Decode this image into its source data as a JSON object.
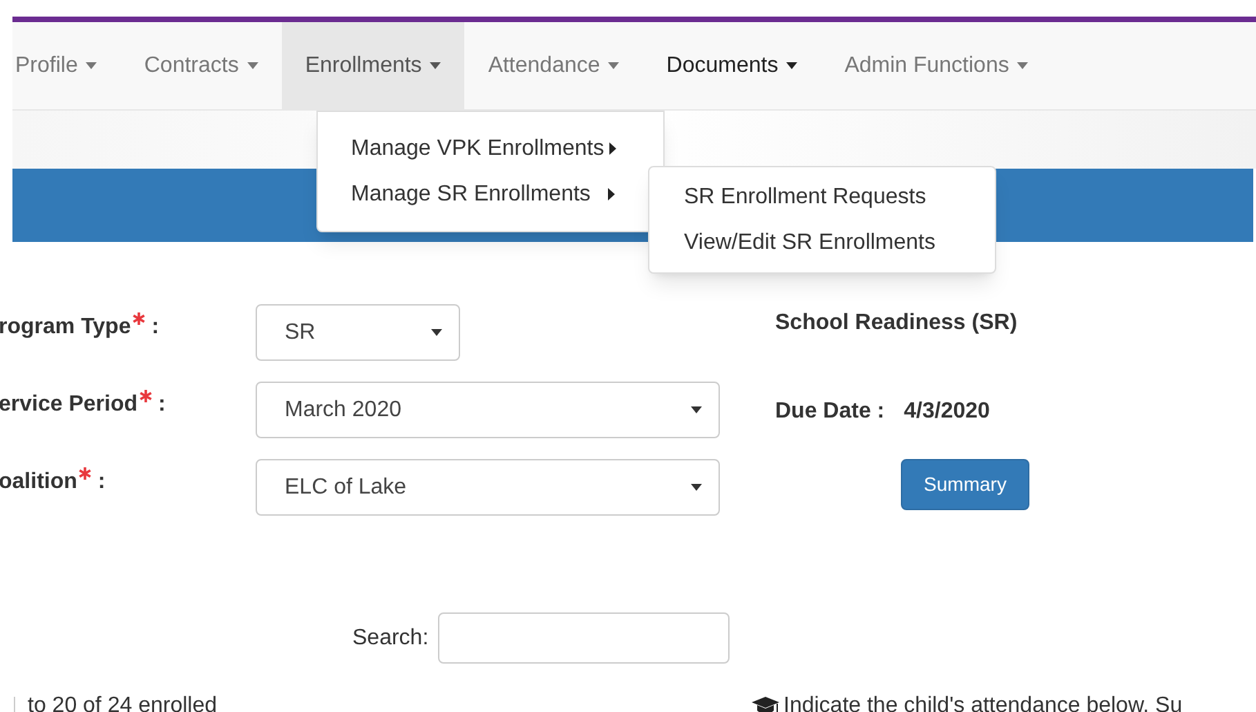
{
  "nav": [
    {
      "label": "Profile",
      "selected": false,
      "hovered": false
    },
    {
      "label": "Contracts",
      "selected": false,
      "hovered": false
    },
    {
      "label": "Enrollments",
      "selected": true,
      "hovered": false
    },
    {
      "label": "Attendance",
      "selected": false,
      "hovered": false
    },
    {
      "label": "Documents",
      "selected": false,
      "hovered": true
    },
    {
      "label": "Admin Functions",
      "selected": false,
      "hovered": false
    }
  ],
  "menu": [
    {
      "label": "Manage VPK Enrollments",
      "expanded": false
    },
    {
      "label": "Manage SR Enrollments",
      "expanded": true,
      "children": [
        {
          "label": "SR Enrollment Requests"
        },
        {
          "label": "View/Edit SR Enrollments"
        }
      ]
    }
  ],
  "form": [
    {
      "label": "rogram Type",
      "required": true,
      "colon": ":",
      "value": "SR",
      "wide": false
    },
    {
      "label": "ervice Period",
      "required": true,
      "colon": ":",
      "value": "March 2020",
      "wide": true
    },
    {
      "label": "oalition",
      "required": true,
      "colon": ":",
      "value": "ELC of Lake",
      "wide": true
    }
  ],
  "program_name": "School Readiness (SR)",
  "due_date": {
    "label": "Due Date :",
    "value": "4/3/2020"
  },
  "summary_button": "Summary",
  "search": {
    "label": "Search:"
  },
  "info": "to 20 of 24 enrolled",
  "note": "Indicate the child's attendance below. Su"
}
